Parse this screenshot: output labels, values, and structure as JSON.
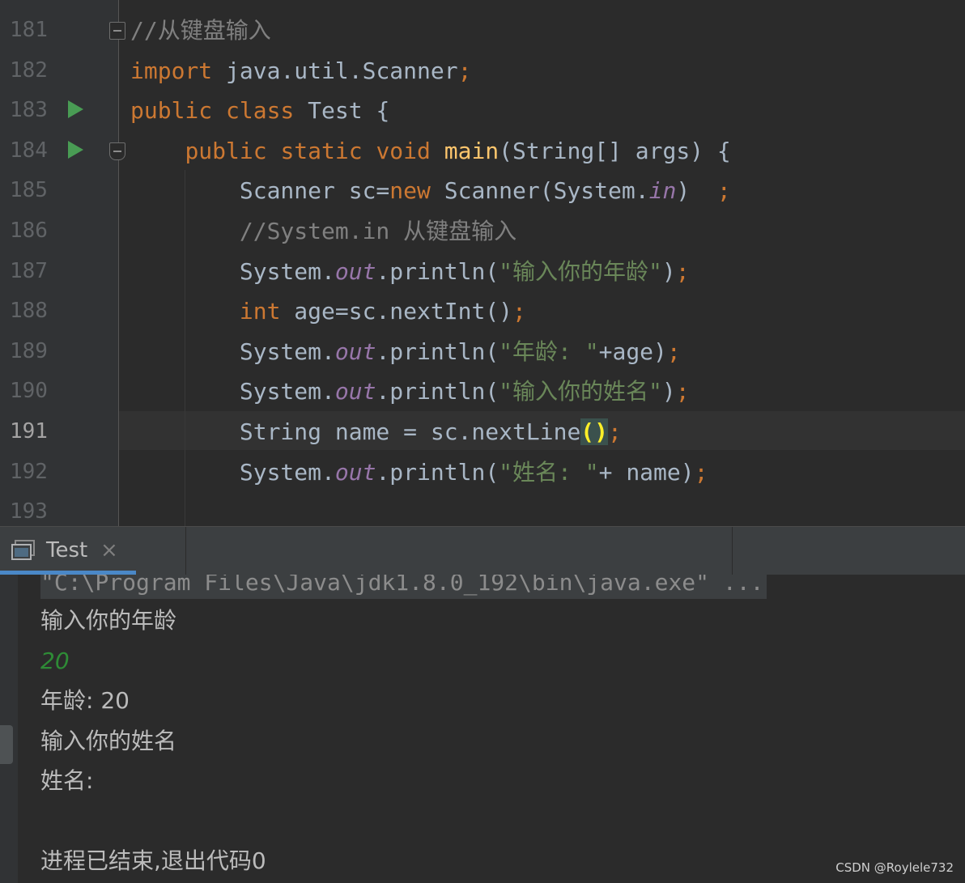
{
  "editor": {
    "lines": [
      {
        "num": "181",
        "parts": [
          [
            "cm",
            "//从键盘输入"
          ]
        ]
      },
      {
        "num": "182",
        "parts": [
          [
            "kw",
            "import "
          ],
          [
            "plain",
            "java.util.Scanner"
          ],
          [
            "kw",
            ";"
          ]
        ]
      },
      {
        "num": "183",
        "parts": [
          [
            "kw",
            "public class "
          ],
          [
            "plain",
            "Test {"
          ]
        ]
      },
      {
        "num": "184",
        "parts": [
          [
            "plain",
            "    "
          ],
          [
            "kw",
            "public static void "
          ],
          [
            "fn",
            "main"
          ],
          [
            "plain",
            "(String[] args) {"
          ]
        ]
      },
      {
        "num": "185",
        "parts": [
          [
            "plain",
            "        Scanner sc="
          ],
          [
            "kw",
            "new "
          ],
          [
            "plain",
            "Scanner(System."
          ],
          [
            "st",
            "in"
          ],
          [
            "plain",
            ")  "
          ],
          [
            "kw",
            ";"
          ]
        ]
      },
      {
        "num": "186",
        "parts": [
          [
            "plain",
            "        "
          ],
          [
            "cm",
            "//System.in 从键盘输入"
          ]
        ]
      },
      {
        "num": "187",
        "parts": [
          [
            "plain",
            "        System."
          ],
          [
            "st",
            "out"
          ],
          [
            "plain",
            ".println("
          ],
          [
            "str",
            "\"输入你的年龄\""
          ],
          [
            "plain",
            ")"
          ],
          [
            "kw",
            ";"
          ]
        ]
      },
      {
        "num": "188",
        "parts": [
          [
            "plain",
            "        "
          ],
          [
            "kw",
            "int "
          ],
          [
            "plain",
            "age=sc.nextInt()"
          ],
          [
            "kw",
            ";"
          ]
        ]
      },
      {
        "num": "189",
        "parts": [
          [
            "plain",
            "        System."
          ],
          [
            "st",
            "out"
          ],
          [
            "plain",
            ".println("
          ],
          [
            "str",
            "\"年龄: \""
          ],
          [
            "plain",
            "+age)"
          ],
          [
            "kw",
            ";"
          ]
        ]
      },
      {
        "num": "190",
        "parts": [
          [
            "plain",
            "        System."
          ],
          [
            "st",
            "out"
          ],
          [
            "plain",
            ".println("
          ],
          [
            "str",
            "\"输入你的姓名\""
          ],
          [
            "plain",
            ")"
          ],
          [
            "kw",
            ";"
          ]
        ]
      },
      {
        "num": "191",
        "parts": [
          [
            "plain",
            "        String name = sc.nextLine"
          ],
          [
            "brace-match",
            "()"
          ],
          [
            "kw",
            ";"
          ]
        ]
      },
      {
        "num": "192",
        "parts": [
          [
            "plain",
            "        System."
          ],
          [
            "st",
            "out"
          ],
          [
            "plain",
            ".println("
          ],
          [
            "str",
            "\"姓名: \""
          ],
          [
            "plain",
            "+ name)"
          ],
          [
            "kw",
            ";"
          ]
        ]
      },
      {
        "num": "193",
        "parts": []
      }
    ],
    "active_line": "191"
  },
  "run_panel": {
    "tab_label": "Test",
    "close_glyph": "×"
  },
  "console": {
    "command": "\"C:\\Program Files\\Java\\jdk1.8.0_192\\bin\\java.exe\" ...",
    "output": [
      {
        "text": "输入你的年龄",
        "type": "out"
      },
      {
        "text": "20",
        "type": "input"
      },
      {
        "text": "年龄: 20",
        "type": "out"
      },
      {
        "text": "输入你的姓名",
        "type": "out"
      },
      {
        "text": "姓名:",
        "type": "out"
      },
      {
        "text": "",
        "type": "out"
      },
      {
        "text": "进程已结束,退出代码0",
        "type": "out"
      }
    ]
  },
  "watermark": "CSDN @Roylele732",
  "colors": {
    "keyword": "#cc7832",
    "string": "#6a8759",
    "comment": "#808080",
    "method": "#ffc66d",
    "static_field": "#9876aa",
    "run_icon": "#499c54",
    "tab_underline": "#4a88c7"
  }
}
